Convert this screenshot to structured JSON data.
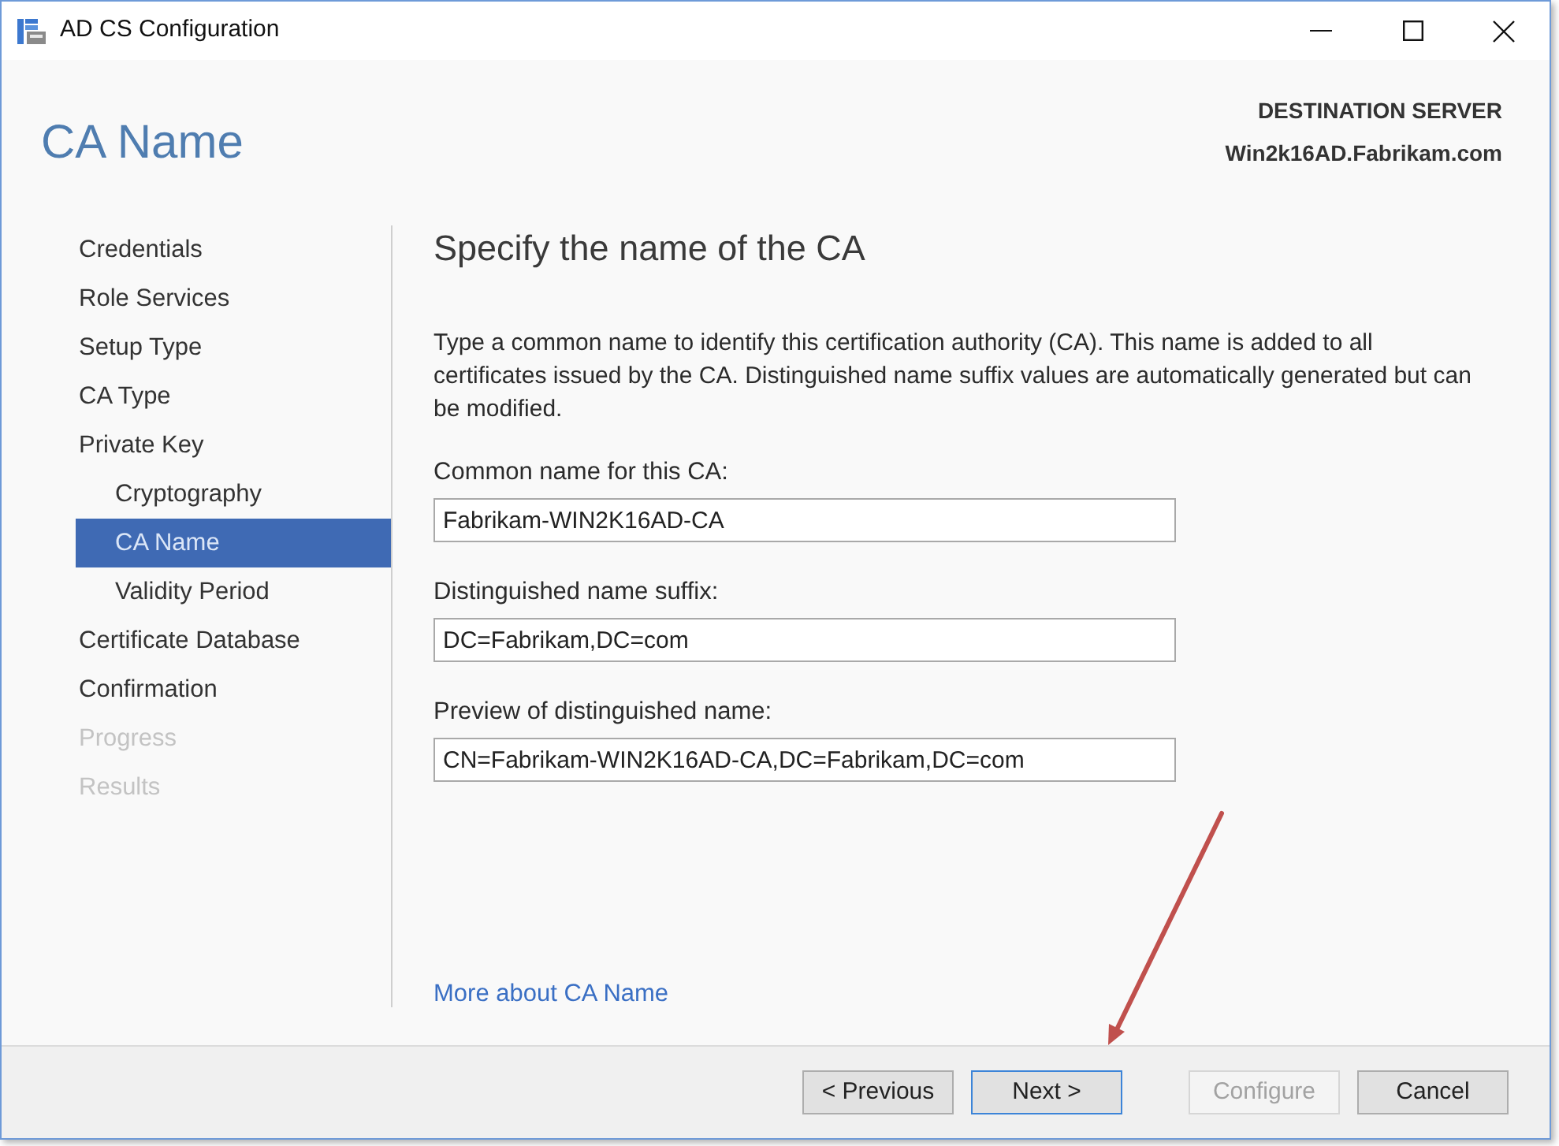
{
  "window": {
    "title": "AD CS Configuration"
  },
  "header": {
    "page_title": "CA Name",
    "server_label": "DESTINATION SERVER",
    "server_name": "Win2k16AD.Fabrikam.com"
  },
  "sidebar": {
    "items": [
      {
        "label": "Credentials",
        "selected": false,
        "disabled": false
      },
      {
        "label": "Role Services",
        "selected": false,
        "disabled": false
      },
      {
        "label": "Setup Type",
        "selected": false,
        "disabled": false
      },
      {
        "label": "CA Type",
        "selected": false,
        "disabled": false
      },
      {
        "label": "Private Key",
        "selected": false,
        "disabled": false,
        "children": [
          {
            "label": "Cryptography",
            "selected": false,
            "disabled": false
          },
          {
            "label": "CA Name",
            "selected": true,
            "disabled": false
          },
          {
            "label": "Validity Period",
            "selected": false,
            "disabled": false
          }
        ]
      },
      {
        "label": "Certificate Database",
        "selected": false,
        "disabled": false
      },
      {
        "label": "Confirmation",
        "selected": false,
        "disabled": false
      },
      {
        "label": "Progress",
        "selected": false,
        "disabled": true
      },
      {
        "label": "Results",
        "selected": false,
        "disabled": true
      }
    ]
  },
  "content": {
    "heading": "Specify the name of the CA",
    "description": "Type a common name to identify this certification authority (CA). This name is added to all certificates issued by the CA. Distinguished name suffix values are automatically generated but can be modified.",
    "fields": [
      {
        "label": "Common name for this CA:",
        "value": "Fabrikam-WIN2K16AD-CA"
      },
      {
        "label": "Distinguished name suffix:",
        "value": "DC=Fabrikam,DC=com"
      },
      {
        "label": "Preview of distinguished name:",
        "value": "CN=Fabrikam-WIN2K16AD-CA,DC=Fabrikam,DC=com"
      }
    ],
    "link": "More about CA Name"
  },
  "footer": {
    "nav_buttons": [
      {
        "label": "< Previous",
        "disabled": false,
        "focused": false
      },
      {
        "label": "Next >",
        "disabled": false,
        "focused": true
      }
    ],
    "action_buttons": [
      {
        "label": "Configure",
        "disabled": true,
        "focused": false
      },
      {
        "label": "Cancel",
        "disabled": false,
        "focused": false
      }
    ]
  }
}
